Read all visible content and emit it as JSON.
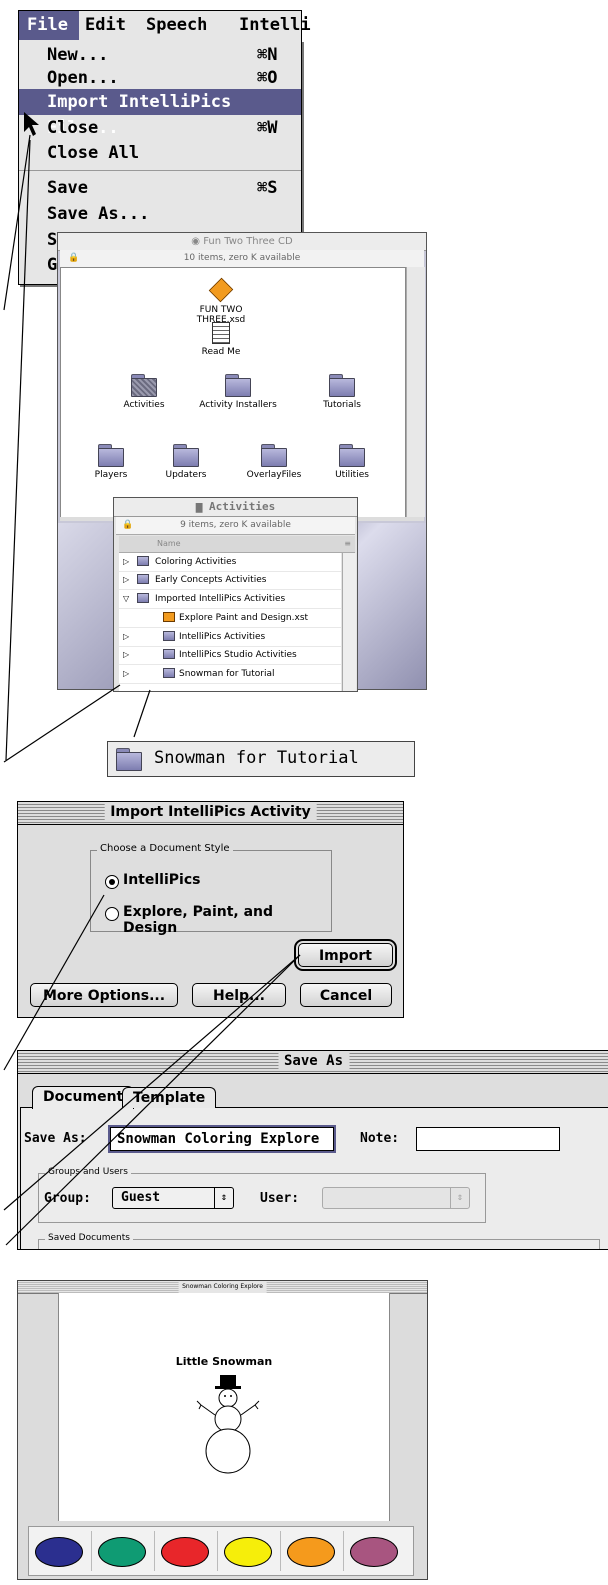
{
  "menubar": {
    "items": [
      "File",
      "Edit",
      "Speech",
      "Intelli"
    ]
  },
  "file_menu": {
    "items": [
      {
        "label": "New...",
        "shortcut": "⌘N"
      },
      {
        "label": "Open...",
        "shortcut": "⌘O"
      },
      {
        "label": "Import IntelliPics File...",
        "shortcut": ""
      },
      {
        "label": "Close",
        "shortcut": "⌘W"
      },
      {
        "label": "Close All",
        "shortcut": ""
      },
      {
        "label": "Save",
        "shortcut": "⌘S"
      },
      {
        "label": "Save As...",
        "shortcut": ""
      },
      {
        "label": "S",
        "shortcut": ""
      },
      {
        "label": "G",
        "shortcut": ""
      }
    ]
  },
  "cd_window": {
    "title": "Fun Two Three CD",
    "info": "10 items, zero K available",
    "files": [
      {
        "label": "FUN TWO THREE.xsd",
        "icon": "document-app-icon"
      },
      {
        "label": "Read Me",
        "icon": "text-document-icon"
      }
    ],
    "folders_row1": [
      "Activities",
      "Activity Installers",
      "Tutorials"
    ],
    "folders_row2": [
      "Players",
      "Updaters",
      "OverlayFiles",
      "Utilities"
    ]
  },
  "activities_window": {
    "title": "Activities",
    "info": "9 items, zero K available",
    "column": "Name",
    "rows": [
      {
        "label": "Coloring Activities",
        "expanded": false,
        "indent": 0
      },
      {
        "label": "Early Concepts Activities",
        "expanded": false,
        "indent": 0
      },
      {
        "label": "Imported IntelliPics Activities",
        "expanded": true,
        "indent": 0
      },
      {
        "label": "Explore Paint and Design.xst",
        "expanded": null,
        "indent": 1
      },
      {
        "label": "IntelliPics Activities",
        "expanded": false,
        "indent": 1
      },
      {
        "label": "IntelliPics Studio Activities",
        "expanded": false,
        "indent": 1
      },
      {
        "label": "Snowman for Tutorial",
        "expanded": false,
        "indent": 1
      }
    ]
  },
  "callout": {
    "label": "Snowman for Tutorial"
  },
  "import_dialog": {
    "title": "Import IntelliPics Activity",
    "group_label": "Choose a Document Style",
    "options": [
      "IntelliPics",
      "Explore, Paint, and Design"
    ],
    "selected": "IntelliPics",
    "import_label": "Import",
    "more_label": "More Options...",
    "help_label": "Help...",
    "cancel_label": "Cancel"
  },
  "save_as": {
    "title": "Save As",
    "tabs": [
      "Document",
      "Template"
    ],
    "save_as_label": "Save As:",
    "save_as_value": "Snowman Coloring Explore",
    "note_label": "Note:",
    "note_value": "",
    "groups_label": "Groups and Users",
    "group_label": "Group:",
    "group_value": "Guest",
    "user_label": "User:",
    "user_value": "",
    "saved_docs_label": "Saved Documents"
  },
  "doc_window": {
    "title": "Snowman Coloring Explore",
    "heading": "Little Snowman",
    "palette": [
      "#2b2f8f",
      "#0f9b73",
      "#e8262a",
      "#f6ee0a",
      "#f59a1c",
      "#a85580"
    ]
  }
}
